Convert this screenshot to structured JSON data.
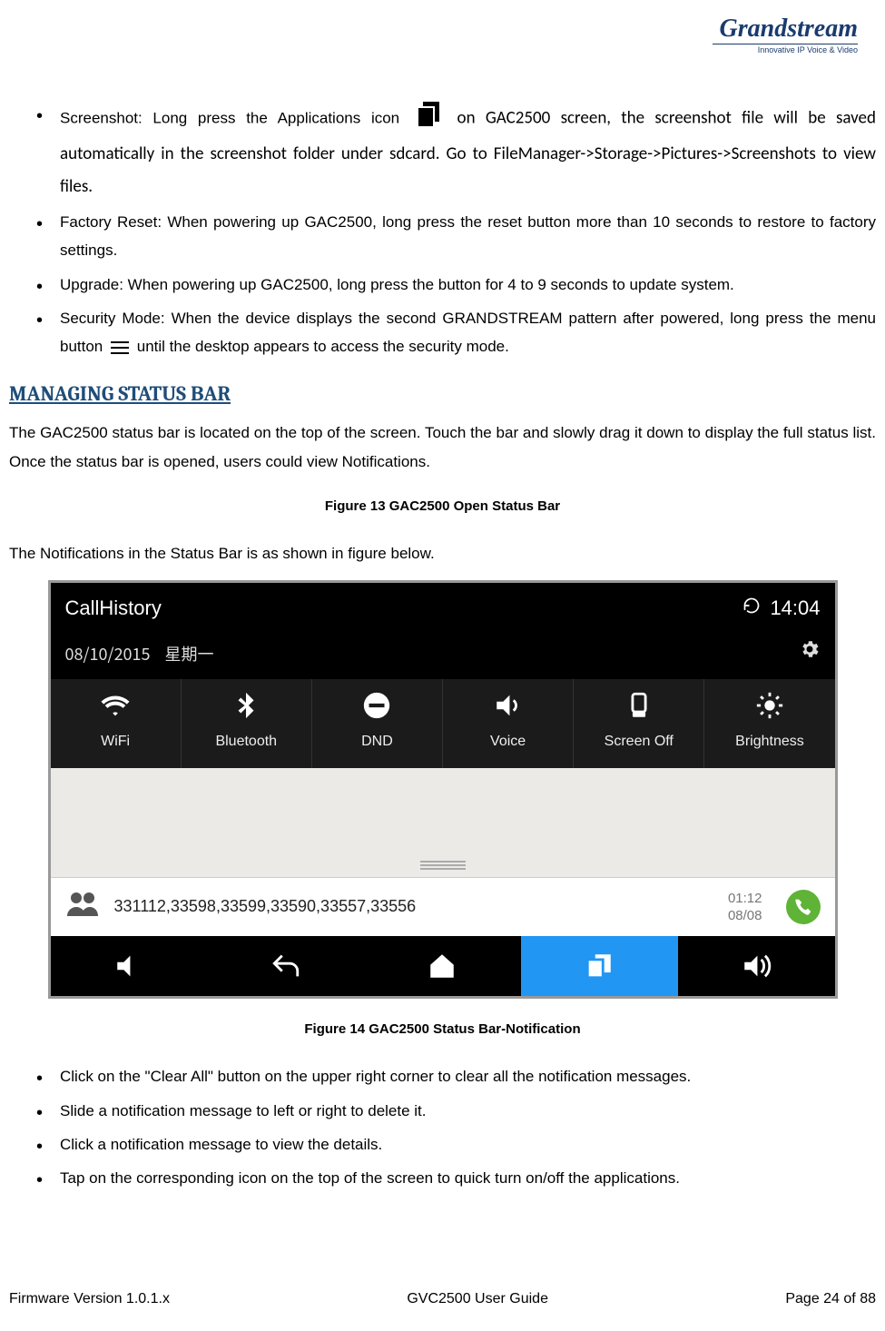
{
  "logo": {
    "brand": "Grandstream",
    "tagline": "Innovative IP Voice & Video"
  },
  "bullets_top": [
    {
      "prefix": "Screenshot: Long press the Applications icon",
      "suffix": " on GAC2500 screen, the screenshot file will be saved automatically in the screenshot folder under sdcard. Go to FileManager->Storage->Pictures->Screenshots to view files."
    },
    {
      "text": "Factory Reset: When powering up GAC2500, long press the reset button more than 10 seconds to restore to factory settings."
    },
    {
      "text": "Upgrade: When powering up GAC2500, long press the button for 4 to 9 seconds to update system."
    },
    {
      "prefix": "Security Mode: When the device displays the second GRANDSTREAM pattern after powered, long press the menu button ",
      "suffix": " until the desktop appears to access the security mode."
    }
  ],
  "section_heading": "MANAGING STATUS BAR",
  "section_para1": "The GAC2500 status bar is located on the top of the screen. Touch the bar and slowly drag it down to display the full status list. Once the status bar is opened, users could view Notifications.",
  "fig13_caption": "Figure 13 GAC2500 Open Status Bar",
  "section_para2": "The Notifications in the Status Bar is as shown in figure below.",
  "shot": {
    "title": "CallHistory",
    "time": "14:04",
    "date": "08/10/2015",
    "weekday": "星期一",
    "quick": [
      "WiFi",
      "Bluetooth",
      "DND",
      "Voice",
      "Screen Off",
      "Brightness"
    ],
    "notif_numbers": "331112,33598,33599,33590,33557,33556",
    "notif_time": "01:12",
    "notif_date": "08/08"
  },
  "fig14_caption": "Figure 14 GAC2500 Status Bar-Notification",
  "bullets_bottom": [
    "Click on the \"Clear All\" button on the upper right corner to clear all the notification messages.",
    "Slide a notification message to left or right to delete it.",
    "Click a notification message to view the details.",
    "Tap on the corresponding icon on the top of the screen to quick turn on/off the applications."
  ],
  "footer": {
    "left": "Firmware Version 1.0.1.x",
    "center": "GVC2500 User Guide",
    "right": "Page 24 of 88"
  }
}
